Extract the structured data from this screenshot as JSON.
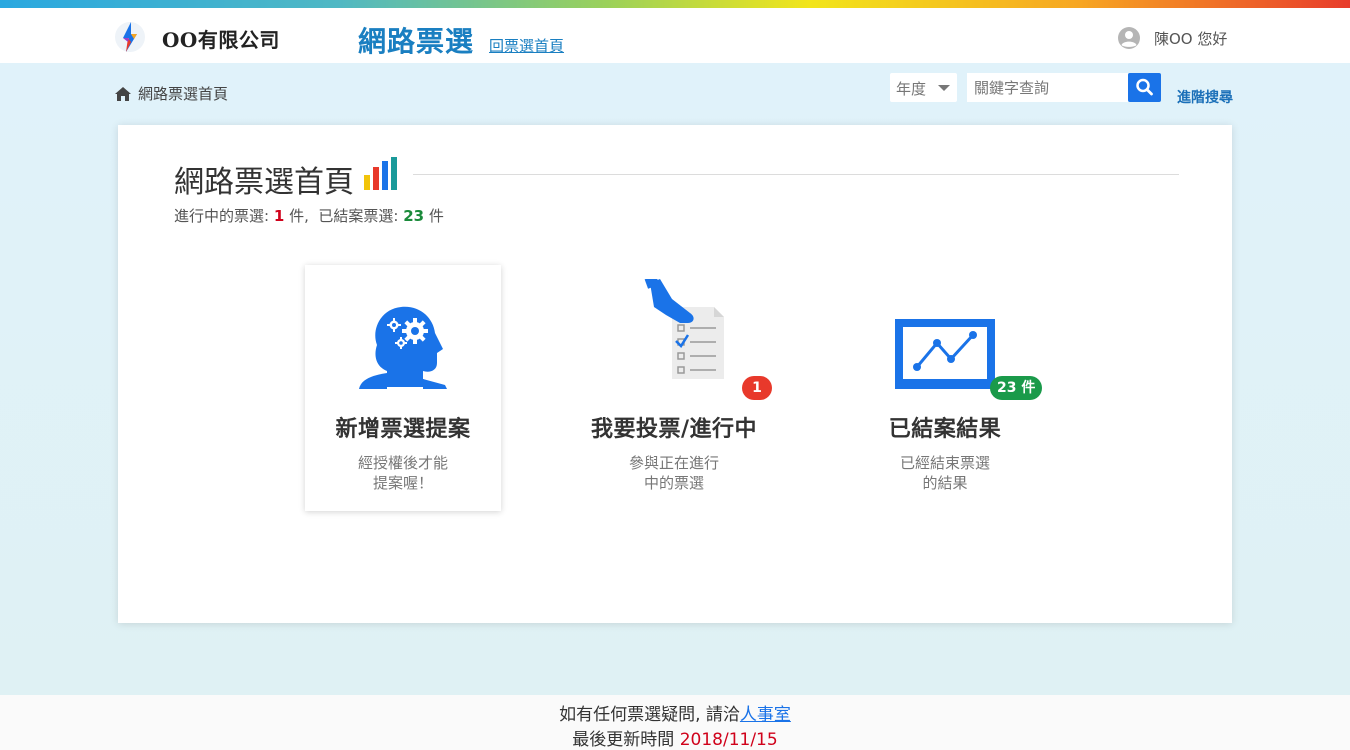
{
  "header": {
    "company_name": "OO有限公司",
    "site_title": "網路票選",
    "back_link": "回票選首頁",
    "user_greeting": "陳OO 您好"
  },
  "breadcrumb": {
    "label": "網路票選首頁"
  },
  "search": {
    "year_label": "年度",
    "placeholder": "關鍵字查詢",
    "advanced_label": "進階搜尋"
  },
  "main": {
    "title": "網路票選首頁",
    "summary": {
      "ongoing_label": "進行中的票選:",
      "ongoing_count": "1",
      "ongoing_unit": "件,",
      "closed_label": "已結案票選:",
      "closed_count": "23",
      "closed_unit": "件"
    },
    "tiles": [
      {
        "name": "新增票選提案",
        "desc_line1": "經授權後才能",
        "desc_line2": "提案喔！",
        "icon": "head-gears-icon"
      },
      {
        "name": "我要投票/進行中",
        "desc_line1": "參與正在進行",
        "desc_line2": "中的票選",
        "badge": "1 件",
        "icon": "ballot-vote-icon"
      },
      {
        "name": "已結案結果",
        "desc_line1": "已經結束票選",
        "desc_line2": "的結果",
        "badge": "23 件",
        "icon": "monitor-chart-icon"
      }
    ]
  },
  "footer": {
    "line1_text": "如有任何票選疑問, 請洽",
    "contact_link": "人事室",
    "line2_label": "最後更新時間",
    "updated_date": "2018/11/15"
  },
  "colors": {
    "primary_blue": "#1a73e8",
    "title_blue": "#1a7fc1",
    "badge_red": "#e8392b",
    "badge_green": "#1a9a4a"
  }
}
